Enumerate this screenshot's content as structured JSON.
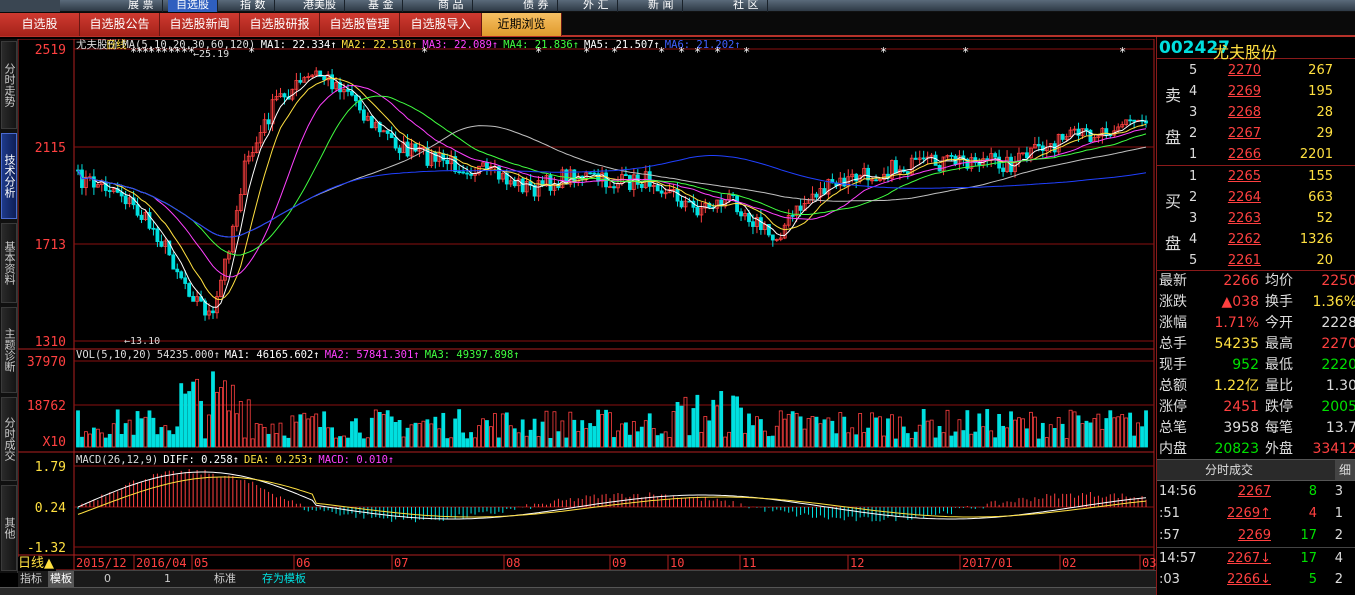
{
  "top_menu": [
    "展 票",
    "自选股",
    "指 数",
    "港美股",
    "基 金",
    "商 品",
    "债 券",
    "外 汇",
    "新 闻",
    "社 区"
  ],
  "tabs": [
    "自选股",
    "自选股公告",
    "自选股新闻",
    "自选股研报",
    "自选股管理",
    "自选股导入",
    "近期浏览"
  ],
  "sidebar": [
    "分时走势",
    "技术分析",
    "基本资料",
    "主题诊断",
    "分时成交",
    "其他"
  ],
  "main_panel": {
    "header_name": "尤夫股份",
    "period": "日线",
    "ma_label": "MA(5,10,20,30,60,120)",
    "ma_values": [
      {
        "label": "MA1:",
        "value": "22.334",
        "color": "#ffffff"
      },
      {
        "label": "MA2:",
        "value": "22.510",
        "color": "#ffe040"
      },
      {
        "label": "MA3:",
        "value": "22.089",
        "color": "#ff40ff"
      },
      {
        "label": "MA4:",
        "value": "21.836",
        "color": "#40ff40"
      },
      {
        "label": "MA5:",
        "value": "21.507",
        "color": "#ffffff"
      },
      {
        "label": "MA6:",
        "value": "21.202",
        "color": "#4060ff"
      }
    ],
    "price_axis": [
      "2519",
      "2115",
      "1713",
      "1310"
    ],
    "high_label": "25.19",
    "low_label": "13.10",
    "vol_label": "VOL(5,10,20)",
    "vol_value": "54235.000",
    "vol_ma": [
      {
        "label": "MA1:",
        "value": "46165.602",
        "color": "#ffffff"
      },
      {
        "label": "MA2:",
        "value": "57841.301",
        "color": "#ff40ff"
      },
      {
        "label": "MA3:",
        "value": "49397.898",
        "color": "#40ff40"
      }
    ],
    "vol_axis": [
      "37970",
      "18762",
      "X10"
    ],
    "macd_label": "MACD(26,12,9)",
    "macd_values": [
      {
        "label": "DIFF:",
        "value": "0.258",
        "color": "#ffffff"
      },
      {
        "label": "DEA:",
        "value": "0.253",
        "color": "#ffe040"
      },
      {
        "label": "MACD:",
        "value": "0.010",
        "color": "#ff40ff"
      }
    ],
    "macd_axis": [
      "1.79",
      "0.24",
      "-1.32"
    ],
    "date_axis": [
      "2015/12",
      "2016/04",
      "05",
      "06",
      "07",
      "08",
      "09",
      "10",
      "11",
      "12",
      "2017/01",
      "02",
      "03"
    ]
  },
  "bottom_bar": {
    "period_button": "日线▲",
    "indicator": "指标",
    "template": "模板",
    "v0": "0",
    "v1": "1",
    "standard": "标准",
    "save_template": "存为模板"
  },
  "stock": {
    "code": "002427",
    "name": "尤夫股份"
  },
  "order_book": {
    "sell_label": [
      "卖",
      "盘"
    ],
    "buy_label": [
      "买",
      "盘"
    ],
    "sell": [
      {
        "n": "5",
        "price": "2270",
        "vol": "267"
      },
      {
        "n": "4",
        "price": "2269",
        "vol": "195"
      },
      {
        "n": "3",
        "price": "2268",
        "vol": "28"
      },
      {
        "n": "2",
        "price": "2267",
        "vol": "29"
      },
      {
        "n": "1",
        "price": "2266",
        "vol": "2201"
      }
    ],
    "buy": [
      {
        "n": "1",
        "price": "2265",
        "vol": "155"
      },
      {
        "n": "2",
        "price": "2264",
        "vol": "663"
      },
      {
        "n": "3",
        "price": "2263",
        "vol": "52"
      },
      {
        "n": "4",
        "price": "2262",
        "vol": "1326"
      },
      {
        "n": "5",
        "price": "2261",
        "vol": "20"
      }
    ]
  },
  "quote": [
    {
      "l1": "最新",
      "v1": "2266",
      "c1": "red",
      "l2": "均价",
      "v2": "2250",
      "c2": "red"
    },
    {
      "l1": "涨跌",
      "v1": "▲038",
      "c1": "red",
      "l2": "换手",
      "v2": "1.36%",
      "c2": "yel"
    },
    {
      "l1": "涨幅",
      "v1": "1.71%",
      "c1": "red",
      "l2": "今开",
      "v2": "2228",
      "c2": "wht"
    },
    {
      "l1": "总手",
      "v1": "54235",
      "c1": "yel",
      "l2": "最高",
      "v2": "2270",
      "c2": "red"
    },
    {
      "l1": "现手",
      "v1": "952",
      "c1": "grn",
      "l2": "最低",
      "v2": "2220",
      "c2": "grn"
    },
    {
      "l1": "总额",
      "v1": "1.22亿",
      "c1": "yel",
      "l2": "量比",
      "v2": "1.30",
      "c2": "wht"
    },
    {
      "l1": "涨停",
      "v1": "2451",
      "c1": "red",
      "l2": "跌停",
      "v2": "2005",
      "c2": "grn"
    },
    {
      "l1": "总笔",
      "v1": "3958",
      "c1": "wht",
      "l2": "每笔",
      "v2": "13.7",
      "c2": "wht"
    },
    {
      "l1": "内盘",
      "v1": "20823",
      "c1": "grn",
      "l2": "外盘",
      "v2": "33412",
      "c2": "red"
    }
  ],
  "ticks_header": {
    "title": "分时成交",
    "detail": "细"
  },
  "ticks": [
    {
      "time": "14:56",
      "price": "2267",
      "pc": "red",
      "vol": "8",
      "vc": "grn",
      "cnt": "3"
    },
    {
      "time": ":51",
      "price": "2269↑",
      "pc": "red",
      "vol": "4",
      "vc": "red",
      "cnt": "1"
    },
    {
      "time": ":57",
      "price": "2269",
      "pc": "red",
      "vol": "17",
      "vc": "grn",
      "cnt": "2"
    },
    {
      "time": "14:57",
      "price": "2267↓",
      "pc": "red",
      "vol": "17",
      "vc": "grn",
      "cnt": "4"
    },
    {
      "time": ":03",
      "price": "2266↓",
      "pc": "red",
      "vol": "5",
      "vc": "grn",
      "cnt": "2"
    }
  ]
}
